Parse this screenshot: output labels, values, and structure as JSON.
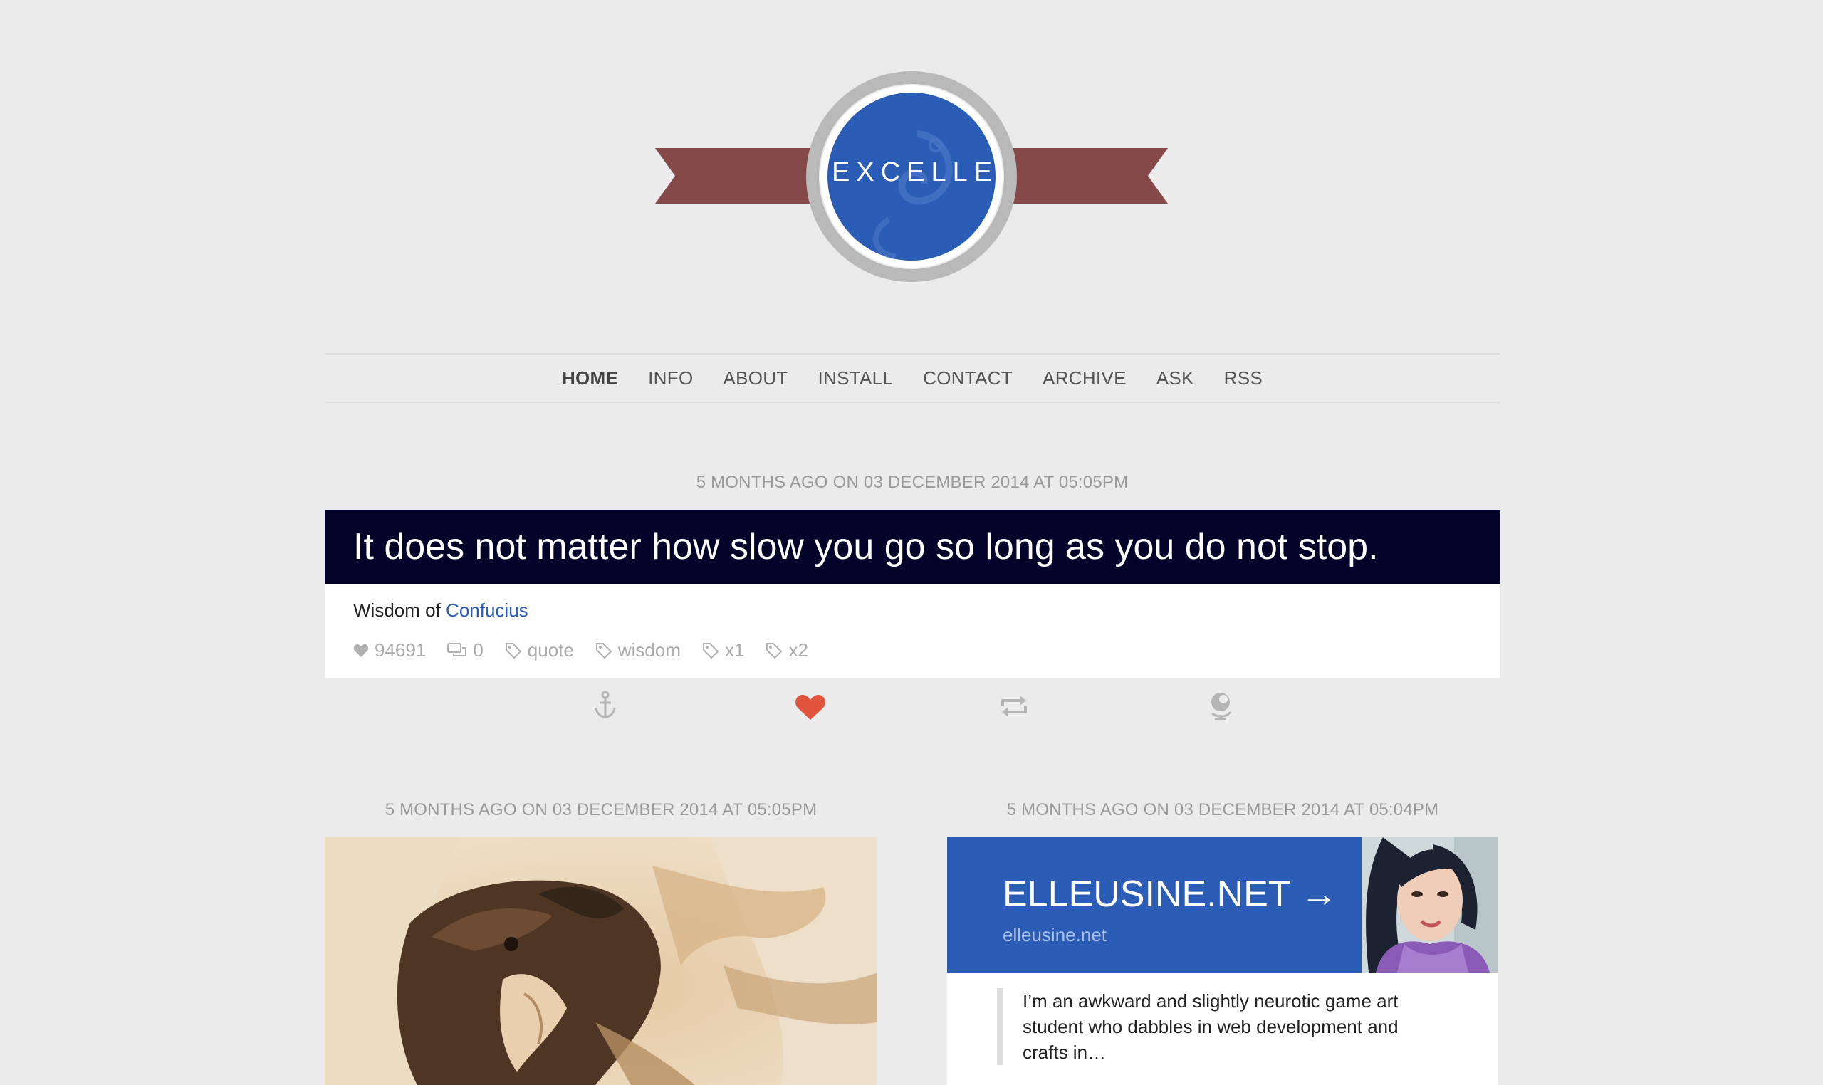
{
  "site": {
    "title": "EXCELLE",
    "colors": {
      "background": "#ebebeb",
      "ribbon": "#864949",
      "badge": "#2b5db6",
      "quote_bg": "#03032a",
      "link": "#2b5db6",
      "heart": "#e0533c"
    }
  },
  "nav": {
    "items": [
      {
        "label": "HOME",
        "active": true
      },
      {
        "label": "INFO"
      },
      {
        "label": "ABOUT"
      },
      {
        "label": "INSTALL"
      },
      {
        "label": "CONTACT"
      },
      {
        "label": "ARCHIVE"
      },
      {
        "label": "ASK"
      },
      {
        "label": "RSS"
      }
    ]
  },
  "quote_post": {
    "date": "5 MONTHS AGO ON 03 DECEMBER 2014 AT 05:05PM",
    "text": "It does not matter how slow you go so long as you do not stop.",
    "source_prefix": "Wisdom of",
    "source_name": "Confucius",
    "likes": "94691",
    "comments": "0",
    "tags": [
      "quote",
      "wisdom",
      "x1",
      "x2"
    ],
    "actions": [
      "anchor-icon",
      "heart-icon",
      "reblog-icon",
      "globe-icon"
    ]
  },
  "photo_post": {
    "date": "5 MONTHS AGO ON 03 DECEMBER 2014 AT 05:05PM"
  },
  "link_post": {
    "date": "5 MONTHS AGO ON 03 DECEMBER 2014 AT 05:04PM",
    "title": "ELLEUSINE.NET →",
    "url": "elleusine.net",
    "excerpt": "I’m an awkward and slightly neurotic game art student who dabbles in web development and crafts in…"
  }
}
